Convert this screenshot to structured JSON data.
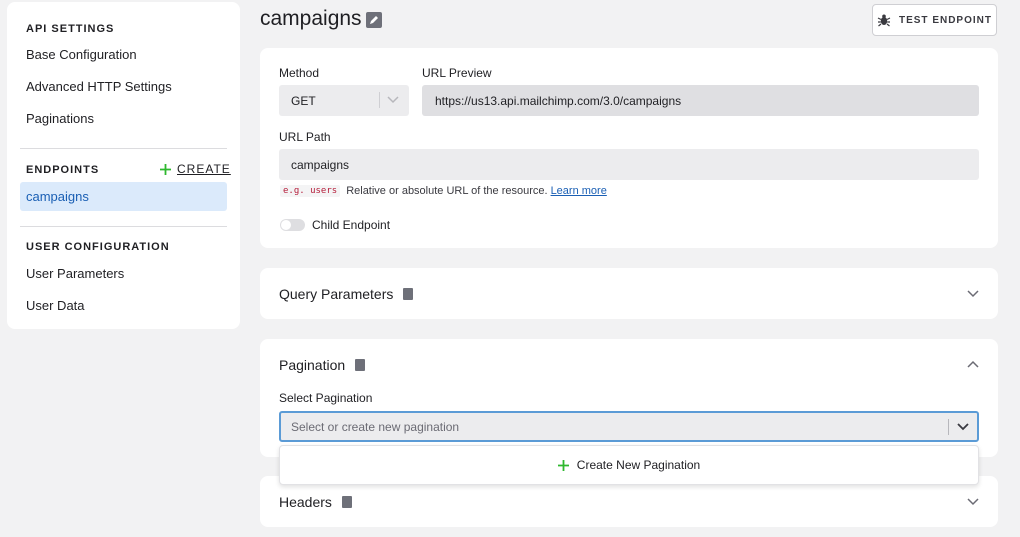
{
  "sidebar": {
    "api_settings_heading": "API SETTINGS",
    "api_settings_items": [
      "Base Configuration",
      "Advanced HTTP Settings",
      "Paginations"
    ],
    "endpoints_heading": "ENDPOINTS",
    "create_label": "CREATE",
    "endpoints": [
      "campaigns"
    ],
    "user_config_heading": "USER CONFIGURATION",
    "user_config_items": [
      "User Parameters",
      "User Data"
    ]
  },
  "header": {
    "title": "campaigns",
    "test_button_label": "TEST ENDPOINT"
  },
  "endpoint_form": {
    "method_label": "Method",
    "method_value": "GET",
    "url_preview_label": "URL Preview",
    "url_preview_value": "https://us13.api.mailchimp.com/3.0/campaigns",
    "url_path_label": "URL Path",
    "url_path_value": "campaigns",
    "hint_code": "e.g. users",
    "hint_text": "Relative or absolute URL of the resource.",
    "hint_link": "Learn more",
    "child_endpoint_label": "Child Endpoint"
  },
  "query_parameters": {
    "title": "Query Parameters"
  },
  "pagination": {
    "title": "Pagination",
    "select_label": "Select Pagination",
    "select_placeholder": "Select or create new pagination",
    "create_option": "Create New Pagination"
  },
  "headers": {
    "title": "Headers"
  },
  "colors": {
    "accent": "#1a5fb4",
    "active_bg": "#dbeafb",
    "plus_green": "#2eb82e",
    "focus_border": "#5b9bd6"
  }
}
